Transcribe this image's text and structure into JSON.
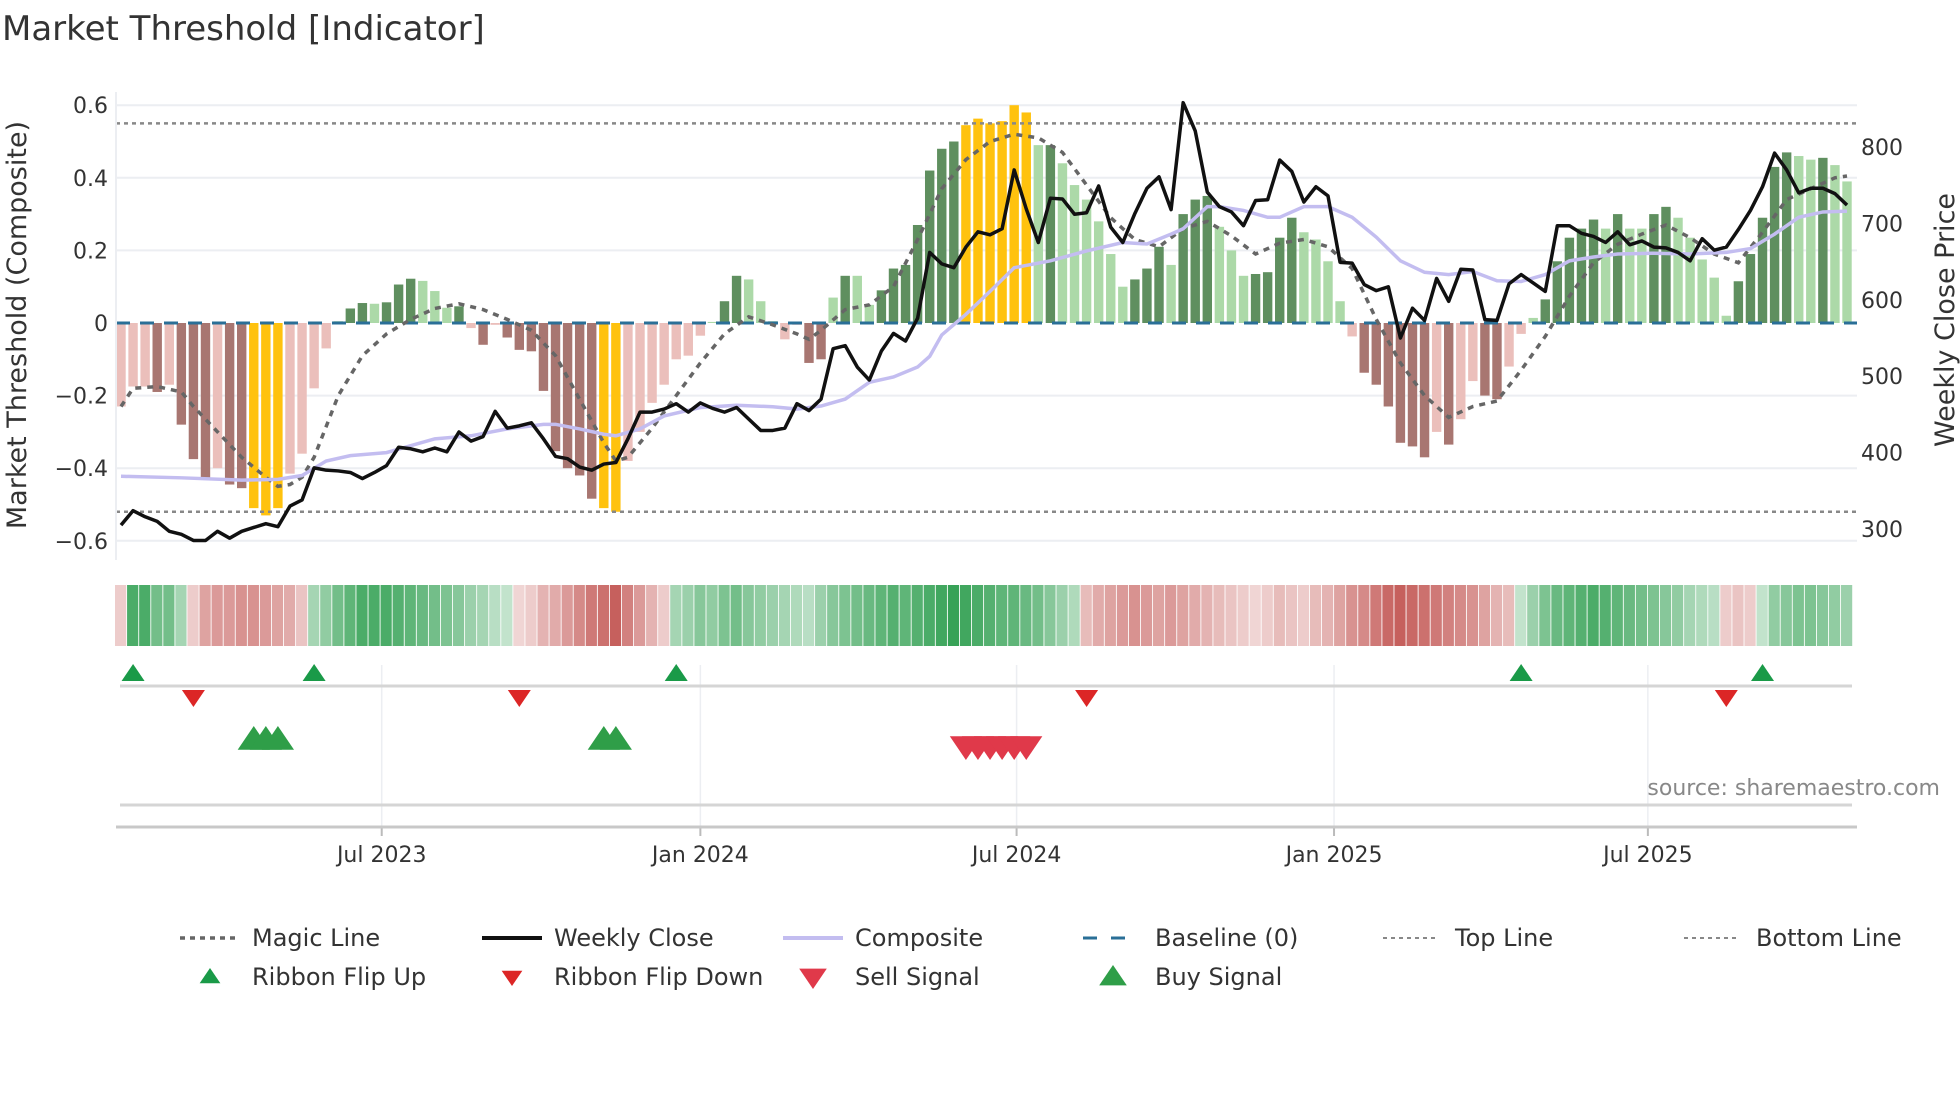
{
  "chart_data": {
    "type": "bar",
    "title": "Market Threshold [Indicator]",
    "ylabel": "Market Threshold (Composite)",
    "ylabel_right": "Weekly Close Price",
    "ylim": [
      -0.66,
      0.66
    ],
    "ylim_right": [
      260,
      855
    ],
    "yticks": [
      {
        "v": 0.6,
        "label": "0.6"
      },
      {
        "v": 0.4,
        "label": "0.4"
      },
      {
        "v": 0.2,
        "label": "0.2"
      },
      {
        "v": 0,
        "label": "0"
      },
      {
        "v": -0.2,
        "label": "−0.2"
      },
      {
        "v": -0.4,
        "label": "−0.4"
      },
      {
        "v": -0.6,
        "label": "−0.6"
      }
    ],
    "yticks_right": [
      {
        "v": 800,
        "label": "800"
      },
      {
        "v": 700,
        "label": "700"
      },
      {
        "v": 600,
        "label": "600"
      },
      {
        "v": 500,
        "label": "500"
      },
      {
        "v": 400,
        "label": "400"
      },
      {
        "v": 300,
        "label": "300"
      }
    ],
    "xticks": [
      {
        "week": 21.6,
        "label": "Jul 2023"
      },
      {
        "week": 48,
        "label": "Jan 2024"
      },
      {
        "week": 74.2,
        "label": "Jul 2024"
      },
      {
        "week": 100.5,
        "label": "Jan 2025"
      },
      {
        "week": 126.5,
        "label": "Jul 2025"
      }
    ],
    "top_line": 0.55,
    "bottom_line": -0.52,
    "grid": true,
    "legend_placement": "bottom",
    "source": "source: sharemaestro.com",
    "colors": {
      "ld": "#ebbfbb",
      "dd": "#a87671",
      "lu": "#acd9a8",
      "du": "#5f8f5f",
      "y": "#ffc20e",
      "close": "#111111",
      "composite": "#c3bdf0",
      "magic": "#666666",
      "baseline": "#2a6f97",
      "refline": "#888888",
      "ribbon_up": "#2e9e4f",
      "ribbon_down": "#c0504d",
      "flip_up": "#1a9a48",
      "flip_down": "#dc2626",
      "sell": "#e0394a",
      "buy": "#2f9e48"
    },
    "composite_bars": {
      "values": [
        -0.23,
        -0.175,
        -0.175,
        -0.19,
        -0.17,
        -0.28,
        -0.375,
        -0.43,
        -0.4,
        -0.445,
        -0.455,
        -0.51,
        -0.53,
        -0.51,
        -0.415,
        -0.36,
        -0.18,
        -0.07,
        0.005,
        0.04,
        0.055,
        0.053,
        0.057,
        0.106,
        0.122,
        0.116,
        0.088,
        0.042,
        0.046,
        -0.014,
        -0.06,
        -0.005,
        -0.04,
        -0.074,
        -0.078,
        -0.187,
        -0.353,
        -0.4,
        -0.42,
        -0.484,
        -0.51,
        -0.52,
        -0.38,
        -0.3,
        -0.22,
        -0.17,
        -0.1,
        -0.09,
        -0.035,
        0.003,
        0.06,
        0.13,
        0.12,
        0.06,
        0.005,
        -0.045,
        -0.005,
        -0.11,
        -0.1,
        0.07,
        0.13,
        0.13,
        0.05,
        0.09,
        0.15,
        0.16,
        0.27,
        0.42,
        0.48,
        0.5,
        0.545,
        0.563,
        0.55,
        0.556,
        0.6,
        0.58,
        0.49,
        0.49,
        0.44,
        0.38,
        0.34,
        0.28,
        0.19,
        0.1,
        0.12,
        0.15,
        0.21,
        0.16,
        0.3,
        0.34,
        0.35,
        0.265,
        0.2,
        0.13,
        0.135,
        0.14,
        0.235,
        0.29,
        0.25,
        0.23,
        0.17,
        0.06,
        -0.037,
        -0.137,
        -0.17,
        -0.23,
        -0.33,
        -0.34,
        -0.37,
        -0.3,
        -0.335,
        -0.265,
        -0.16,
        -0.2,
        -0.21,
        -0.12,
        -0.03,
        0.014,
        0.065,
        0.17,
        0.235,
        0.26,
        0.285,
        0.26,
        0.3,
        0.26,
        0.26,
        0.3,
        0.32,
        0.29,
        0.235,
        0.175,
        0.125,
        0.02,
        0.115,
        0.19,
        0.29,
        0.43,
        0.47,
        0.46,
        0.45,
        0.455,
        0.435,
        0.39
      ],
      "categories": [
        "ld",
        "ld",
        "ld",
        "dd",
        "ld",
        "dd",
        "dd",
        "dd",
        "ld",
        "dd",
        "dd",
        "y",
        "y",
        "y",
        "ld",
        "ld",
        "ld",
        "ld",
        "lu",
        "du",
        "du",
        "lu",
        "du",
        "du",
        "du",
        "lu",
        "lu",
        "lu",
        "du",
        "ld",
        "dd",
        "ld",
        "dd",
        "dd",
        "dd",
        "dd",
        "dd",
        "dd",
        "dd",
        "dd",
        "y",
        "y",
        "ld",
        "ld",
        "ld",
        "ld",
        "ld",
        "ld",
        "ld",
        "lu",
        "du",
        "du",
        "lu",
        "lu",
        "lu",
        "ld",
        "ld",
        "dd",
        "dd",
        "lu",
        "du",
        "lu",
        "lu",
        "du",
        "du",
        "du",
        "du",
        "du",
        "du",
        "du",
        "y",
        "y",
        "y",
        "y",
        "y",
        "y",
        "lu",
        "du",
        "lu",
        "lu",
        "lu",
        "lu",
        "lu",
        "lu",
        "du",
        "du",
        "du",
        "lu",
        "du",
        "du",
        "du",
        "lu",
        "lu",
        "lu",
        "du",
        "du",
        "du",
        "du",
        "lu",
        "lu",
        "lu",
        "lu",
        "ld",
        "dd",
        "dd",
        "dd",
        "dd",
        "dd",
        "dd",
        "ld",
        "dd",
        "ld",
        "ld",
        "dd",
        "dd",
        "ld",
        "ld",
        "lu",
        "du",
        "du",
        "du",
        "du",
        "du",
        "lu",
        "du",
        "lu",
        "lu",
        "du",
        "du",
        "lu",
        "lu",
        "lu",
        "lu",
        "lu",
        "du",
        "du",
        "du",
        "du",
        "du",
        "lu",
        "lu",
        "du",
        "lu",
        "lu"
      ]
    },
    "weekly_close": [
      305,
      324,
      316,
      310,
      297,
      293,
      285,
      285,
      297,
      288,
      297,
      302,
      307,
      303,
      330,
      338,
      380,
      377,
      376,
      374,
      366,
      374,
      383,
      407,
      405,
      401,
      406,
      401,
      427,
      415,
      421,
      454,
      432,
      435,
      439,
      418,
      395,
      392,
      381,
      377,
      385,
      387,
      418,
      453,
      453,
      457,
      464,
      453,
      465,
      458,
      453,
      459,
      444,
      429,
      429,
      432,
      464,
      455,
      470,
      536,
      540,
      512,
      495,
      533,
      556,
      546,
      576,
      662,
      647,
      642,
      669,
      689,
      685,
      693,
      770,
      719,
      675,
      733,
      732,
      712,
      714,
      749,
      695,
      675,
      713,
      746,
      761,
      718,
      858,
      821,
      741,
      722,
      715,
      697,
      730,
      731,
      783,
      768,
      728,
      748,
      736,
      649,
      648,
      620,
      612,
      617,
      550,
      589,
      573,
      628,
      598,
      640,
      639,
      574,
      573,
      621,
      633,
      622,
      611,
      697,
      697,
      687,
      683,
      675,
      689,
      672,
      677,
      669,
      668,
      662,
      651,
      680,
      665,
      669,
      692,
      717,
      748,
      792,
      770,
      740,
      746,
      746,
      739,
      724
    ],
    "composite_line": [
      [
        0,
        369
      ],
      [
        5,
        367
      ],
      [
        10,
        364
      ],
      [
        13,
        365
      ],
      [
        15,
        370
      ],
      [
        17,
        389
      ],
      [
        19,
        396
      ],
      [
        22,
        400
      ],
      [
        24,
        409
      ],
      [
        26,
        418
      ],
      [
        29,
        422
      ],
      [
        32,
        431
      ],
      [
        35,
        437
      ],
      [
        36,
        437
      ],
      [
        38,
        431
      ],
      [
        40,
        424
      ],
      [
        41,
        422
      ],
      [
        43,
        431
      ],
      [
        45,
        448
      ],
      [
        48,
        459
      ],
      [
        51,
        462
      ],
      [
        54,
        460
      ],
      [
        56,
        457
      ],
      [
        58,
        461
      ],
      [
        60,
        470
      ],
      [
        62,
        492
      ],
      [
        64,
        499
      ],
      [
        66,
        512
      ],
      [
        67,
        526
      ],
      [
        68,
        554
      ],
      [
        70,
        581
      ],
      [
        72,
        611
      ],
      [
        74,
        642
      ],
      [
        77,
        651
      ],
      [
        80,
        664
      ],
      [
        83,
        675
      ],
      [
        85,
        673
      ],
      [
        87,
        686
      ],
      [
        88,
        693
      ],
      [
        90,
        722
      ],
      [
        91,
        722
      ],
      [
        93,
        717
      ],
      [
        95,
        708
      ],
      [
        96,
        708
      ],
      [
        98,
        722
      ],
      [
        100,
        722
      ],
      [
        102,
        708
      ],
      [
        104,
        682
      ],
      [
        106,
        651
      ],
      [
        108,
        636
      ],
      [
        110,
        633
      ],
      [
        112,
        637
      ],
      [
        114,
        625
      ],
      [
        116,
        624
      ],
      [
        118,
        633
      ],
      [
        120,
        651
      ],
      [
        122,
        656
      ],
      [
        124,
        660
      ],
      [
        127,
        661
      ],
      [
        130,
        660
      ],
      [
        133,
        662
      ],
      [
        135,
        667
      ],
      [
        137,
        686
      ],
      [
        139,
        708
      ],
      [
        141,
        715
      ],
      [
        143,
        716
      ]
    ],
    "magic_line": [
      [
        0,
        -0.23
      ],
      [
        1,
        -0.18
      ],
      [
        3,
        -0.175
      ],
      [
        5,
        -0.19
      ],
      [
        6,
        -0.23
      ],
      [
        8,
        -0.3
      ],
      [
        10,
        -0.37
      ],
      [
        12,
        -0.425
      ],
      [
        13,
        -0.45
      ],
      [
        14,
        -0.445
      ],
      [
        15,
        -0.425
      ],
      [
        16,
        -0.37
      ],
      [
        18,
        -0.2
      ],
      [
        20,
        -0.09
      ],
      [
        22,
        -0.03
      ],
      [
        24,
        0.01
      ],
      [
        26,
        0.04
      ],
      [
        28,
        0.053
      ],
      [
        30,
        0.037
      ],
      [
        32,
        0.01
      ],
      [
        34,
        -0.02
      ],
      [
        36,
        -0.09
      ],
      [
        38,
        -0.21
      ],
      [
        40,
        -0.33
      ],
      [
        41,
        -0.38
      ],
      [
        42,
        -0.37
      ],
      [
        44,
        -0.29
      ],
      [
        46,
        -0.2
      ],
      [
        48,
        -0.11
      ],
      [
        50,
        -0.03
      ],
      [
        52,
        0.017
      ],
      [
        54,
        -0.005
      ],
      [
        56,
        -0.03
      ],
      [
        57,
        -0.045
      ],
      [
        58,
        -0.02
      ],
      [
        60,
        0.037
      ],
      [
        62,
        0.05
      ],
      [
        64,
        0.1
      ],
      [
        66,
        0.23
      ],
      [
        68,
        0.37
      ],
      [
        70,
        0.45
      ],
      [
        72,
        0.5
      ],
      [
        74,
        0.52
      ],
      [
        76,
        0.51
      ],
      [
        78,
        0.47
      ],
      [
        80,
        0.38
      ],
      [
        82,
        0.29
      ],
      [
        84,
        0.23
      ],
      [
        86,
        0.21
      ],
      [
        88,
        0.26
      ],
      [
        90,
        0.28
      ],
      [
        92,
        0.24
      ],
      [
        94,
        0.19
      ],
      [
        96,
        0.22
      ],
      [
        98,
        0.23
      ],
      [
        100,
        0.21
      ],
      [
        102,
        0.15
      ],
      [
        104,
        0.01
      ],
      [
        106,
        -0.11
      ],
      [
        108,
        -0.2
      ],
      [
        110,
        -0.26
      ],
      [
        112,
        -0.23
      ],
      [
        114,
        -0.215
      ],
      [
        116,
        -0.13
      ],
      [
        118,
        -0.037
      ],
      [
        120,
        0.074
      ],
      [
        122,
        0.166
      ],
      [
        124,
        0.217
      ],
      [
        126,
        0.245
      ],
      [
        128,
        0.27
      ],
      [
        130,
        0.235
      ],
      [
        132,
        0.19
      ],
      [
        134,
        0.166
      ],
      [
        136,
        0.25
      ],
      [
        138,
        0.34
      ],
      [
        140,
        0.37
      ],
      [
        142,
        0.4
      ],
      [
        143,
        0.405
      ]
    ],
    "ribbon": [
      -0.2,
      0.8,
      0.8,
      0.6,
      0.6,
      0.35,
      -0.2,
      -0.45,
      -0.5,
      -0.5,
      -0.55,
      -0.55,
      -0.5,
      -0.45,
      -0.4,
      -0.25,
      0.35,
      0.45,
      0.6,
      0.7,
      0.8,
      0.8,
      0.8,
      0.75,
      0.7,
      0.65,
      0.6,
      0.55,
      0.5,
      0.4,
      0.35,
      0.25,
      0.2,
      -0.15,
      -0.2,
      -0.35,
      -0.4,
      -0.5,
      -0.6,
      -0.7,
      -0.75,
      -0.85,
      -0.65,
      -0.5,
      -0.35,
      -0.2,
      0.35,
      0.4,
      0.5,
      0.45,
      0.55,
      0.6,
      0.5,
      0.45,
      0.4,
      0.35,
      0.3,
      0.25,
      0.4,
      0.5,
      0.55,
      0.6,
      0.65,
      0.7,
      0.75,
      0.7,
      0.75,
      0.8,
      0.85,
      0.9,
      0.85,
      0.8,
      0.75,
      0.7,
      0.7,
      0.65,
      0.6,
      0.5,
      0.4,
      0.3,
      -0.3,
      -0.4,
      -0.45,
      -0.5,
      -0.55,
      -0.5,
      -0.45,
      -0.5,
      -0.45,
      -0.4,
      -0.35,
      -0.3,
      -0.25,
      -0.2,
      -0.15,
      -0.2,
      -0.3,
      -0.25,
      -0.2,
      -0.3,
      -0.35,
      -0.45,
      -0.55,
      -0.6,
      -0.7,
      -0.8,
      -0.85,
      -0.8,
      -0.75,
      -0.7,
      -0.65,
      -0.6,
      -0.55,
      -0.45,
      -0.35,
      -0.3,
      0.2,
      0.4,
      0.55,
      0.65,
      0.7,
      0.75,
      0.8,
      0.75,
      0.7,
      0.65,
      0.6,
      0.55,
      0.5,
      0.45,
      0.35,
      0.3,
      0.25,
      -0.2,
      -0.25,
      -0.2,
      0.2,
      0.45,
      0.5,
      0.55,
      0.55,
      0.5,
      0.45,
      0.4
    ],
    "ribbon_flip_up": [
      1,
      16,
      46,
      116,
      136
    ],
    "ribbon_flip_down": [
      6,
      33,
      80,
      133
    ],
    "buy_signals": [
      11,
      12,
      13,
      40,
      41
    ],
    "sell_signals": [
      70,
      71,
      72,
      73,
      74,
      75
    ],
    "legend": [
      {
        "key": "magic",
        "label": "Magic Line"
      },
      {
        "key": "close",
        "label": "Weekly Close"
      },
      {
        "key": "composite",
        "label": "Composite"
      },
      {
        "key": "baseline",
        "label": "Baseline (0)"
      },
      {
        "key": "top",
        "label": "Top Line"
      },
      {
        "key": "bottom",
        "label": "Bottom Line"
      },
      {
        "key": "flip_up",
        "label": "Ribbon Flip Up"
      },
      {
        "key": "flip_down",
        "label": "Ribbon Flip Down"
      },
      {
        "key": "sell",
        "label": "Sell Signal"
      },
      {
        "key": "buy",
        "label": "Buy Signal"
      }
    ]
  }
}
